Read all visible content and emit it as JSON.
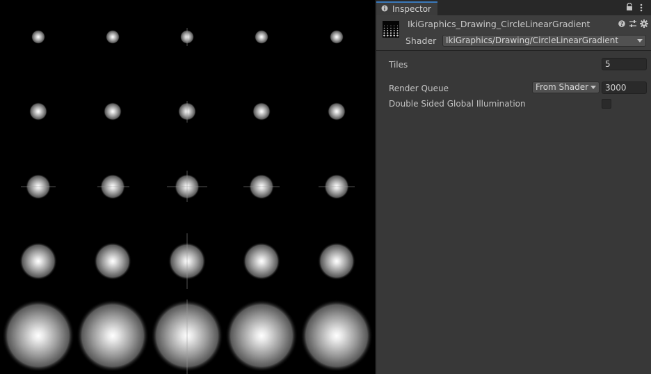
{
  "viewport": {
    "grid": {
      "rows": 5,
      "columns": 5
    }
  },
  "inspector": {
    "tab_label": "Inspector",
    "tab_icon": "info-icon",
    "material_name": "IkiGraphics_Drawing_CircleLinearGradient",
    "header_icons": [
      "help-icon",
      "preset-icon",
      "gear-icon"
    ],
    "shader_label": "Shader",
    "shader_value": "IkiGraphics/Drawing/CircleLinearGradient",
    "properties": {
      "tiles_label": "Tiles",
      "tiles_value": "5",
      "render_queue_label": "Render Queue",
      "render_queue_mode": "From Shader",
      "render_queue_value": "3000",
      "double_sided_gi_label": "Double Sided Global Illumination",
      "double_sided_gi_checked": false
    }
  },
  "colors": {
    "accent": "#3a79bb",
    "panel": "#383838",
    "viewport_bg": "#000000"
  }
}
